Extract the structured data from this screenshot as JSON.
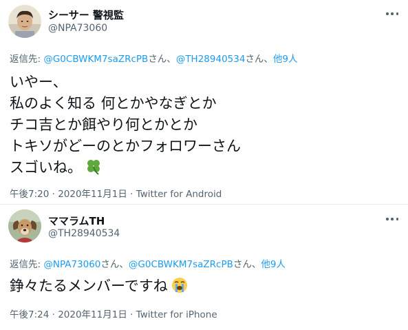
{
  "tweets": [
    {
      "user": {
        "display_name": "シーサー 警視監",
        "handle": "@NPA73060"
      },
      "reply_prefix": "返信先: ",
      "reply_to": [
        {
          "text": "@G0CBWKM7saZRcPB"
        },
        {
          "text": "さん、"
        },
        {
          "text": "@TH28940534"
        },
        {
          "text": "さん、"
        },
        {
          "text": "他9人"
        }
      ],
      "body_lines": [
        "いやー、",
        "私のよく知る 何とかやなぎとか",
        "チコ吉とか餌やり何とかとか",
        "トキソがどーのとかフォロワーさん",
        "スゴいね。"
      ],
      "emoji": "four-leaf-clover",
      "time": "午後7:20",
      "sep": " · ",
      "date": "2020年11月1日",
      "source": "Twitter for Android"
    },
    {
      "user": {
        "display_name": "ママラムTH",
        "handle": "@TH28940534"
      },
      "reply_prefix": "返信先: ",
      "reply_to": [
        {
          "text": "@NPA73060"
        },
        {
          "text": "さん、"
        },
        {
          "text": "@G0CBWKM7saZRcPB"
        },
        {
          "text": "さん、"
        },
        {
          "text": "他9人"
        }
      ],
      "body_lines": [
        "錚々たるメンバーですね"
      ],
      "emoji": "loudly-crying-face",
      "time": "午後7:24",
      "sep": " · ",
      "date": "2020年11月1日",
      "source": "Twitter for iPhone"
    }
  ],
  "colors": {
    "link": "#1d9bf0",
    "secondary": "#536471",
    "text": "#0f1419"
  }
}
